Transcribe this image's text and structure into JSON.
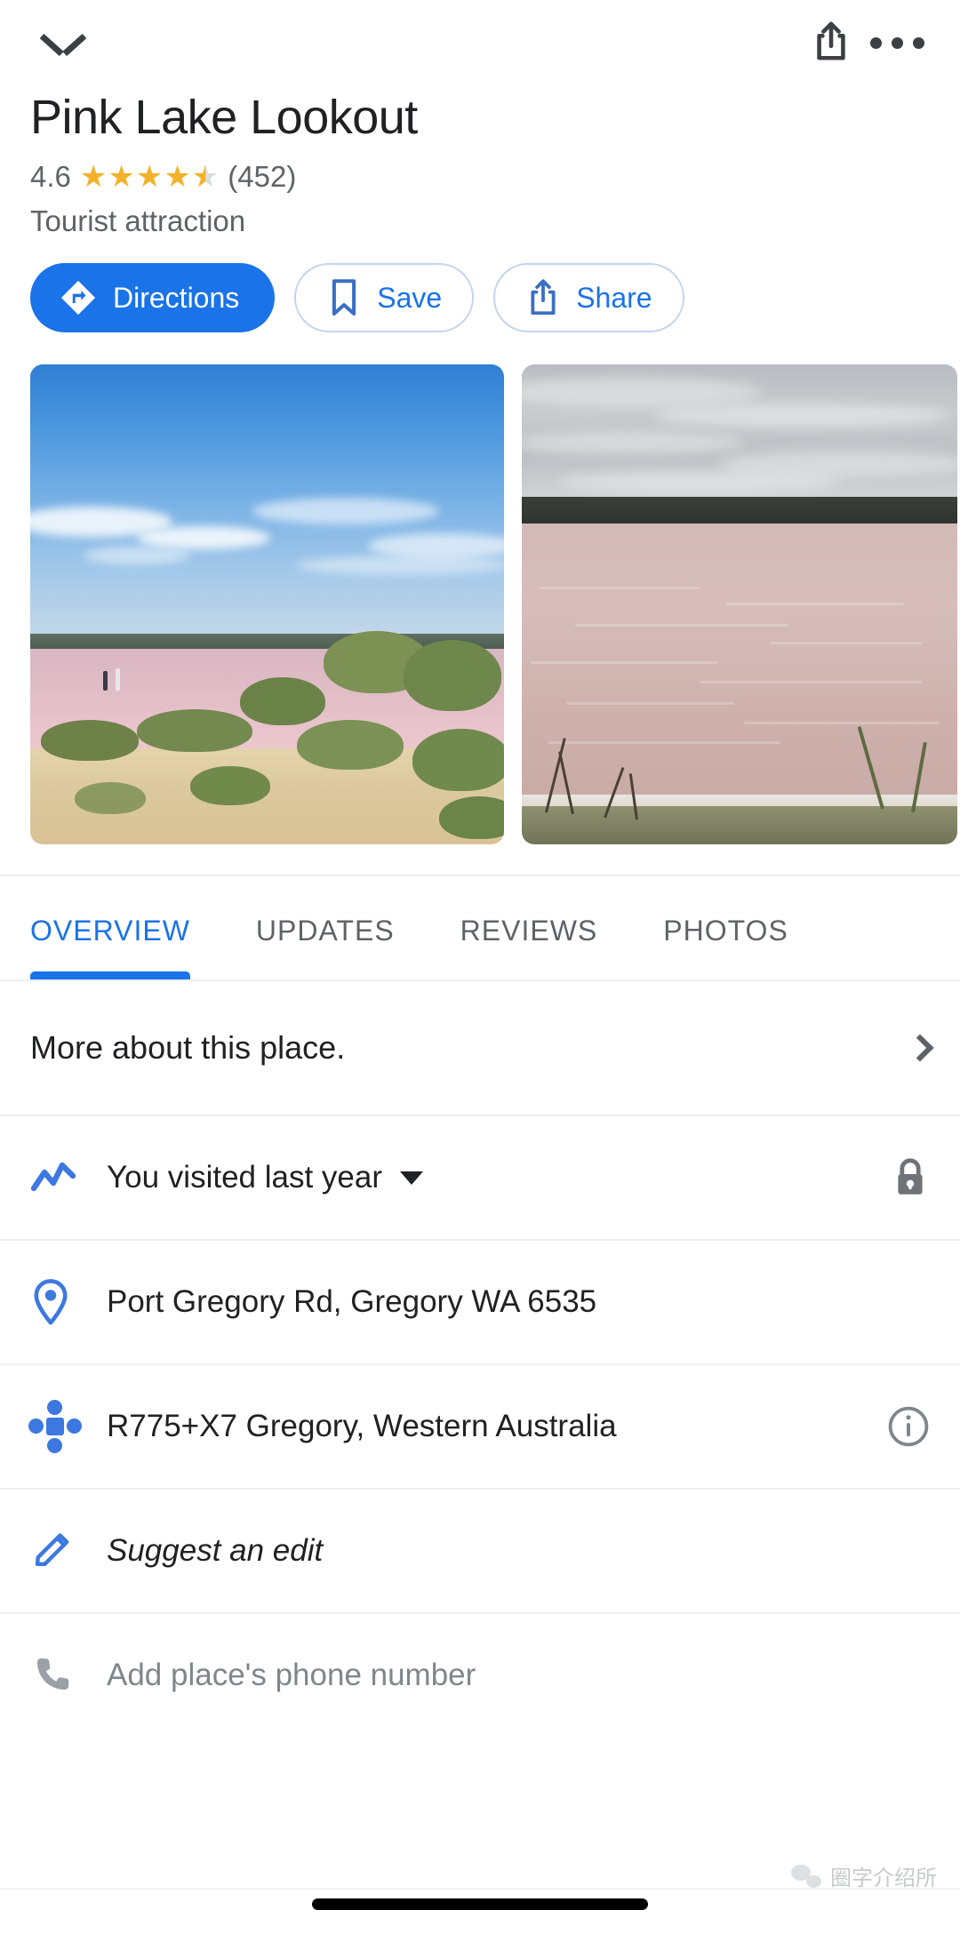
{
  "topbar": {
    "collapse_icon": "chevron-down-icon",
    "share_icon": "share-icon",
    "more_icon": "more-options-icon"
  },
  "place": {
    "title": "Pink Lake Lookout",
    "rating": "4.6",
    "stars_filled": 4,
    "stars_half": 1,
    "review_count": "(452)",
    "category": "Tourist attraction"
  },
  "actions": [
    {
      "label": "Directions",
      "icon": "directions-icon",
      "style": "primary"
    },
    {
      "label": "Save",
      "icon": "bookmark-icon",
      "style": "outline"
    },
    {
      "label": "Share",
      "icon": "share-icon",
      "style": "outline"
    }
  ],
  "photos": [
    {
      "name": "pink-lake-beach-photo",
      "alt": "Pink lake with blue sky, sandy dunes and two people on the shore"
    },
    {
      "name": "pink-lake-overcast-photo",
      "alt": "Pink salt lake under overcast grey clouds"
    }
  ],
  "tabs": [
    {
      "label": "OVERVIEW",
      "active": true
    },
    {
      "label": "UPDATES",
      "active": false
    },
    {
      "label": "REVIEWS",
      "active": false
    },
    {
      "label": "PHOTOS",
      "active": false
    }
  ],
  "more_about": {
    "label": "More about this place.",
    "chevron": "chevron-right-icon"
  },
  "info_rows": [
    {
      "name": "visited-row",
      "icon": "timeline-icon",
      "label": "You visited last year",
      "has_caret": true,
      "trailing_icon": "lock-icon",
      "muted": false,
      "italic": false
    },
    {
      "name": "address-row",
      "icon": "map-pin-icon",
      "label": "Port Gregory Rd, Gregory WA 6535",
      "has_caret": false,
      "trailing_icon": "",
      "muted": false,
      "italic": false
    },
    {
      "name": "plus-code-row",
      "icon": "plus-code-icon",
      "label": "R775+X7 Gregory, Western Australia",
      "has_caret": false,
      "trailing_icon": "info-icon",
      "muted": false,
      "italic": false
    },
    {
      "name": "suggest-edit-row",
      "icon": "pencil-icon",
      "label": "Suggest an edit",
      "has_caret": false,
      "trailing_icon": "",
      "muted": false,
      "italic": true
    },
    {
      "name": "add-phone-row",
      "icon": "phone-icon",
      "label": "Add place's phone number",
      "has_caret": false,
      "trailing_icon": "",
      "muted": true,
      "italic": false
    }
  ],
  "watermark": {
    "text": "圈字介绍所",
    "icon": "wechat-icon"
  },
  "colors": {
    "accent": "#1a73e8",
    "star": "#f3b229",
    "text_primary": "#202124",
    "text_secondary": "#5f6368",
    "text_muted": "#80868b",
    "divider": "#eceff1"
  }
}
